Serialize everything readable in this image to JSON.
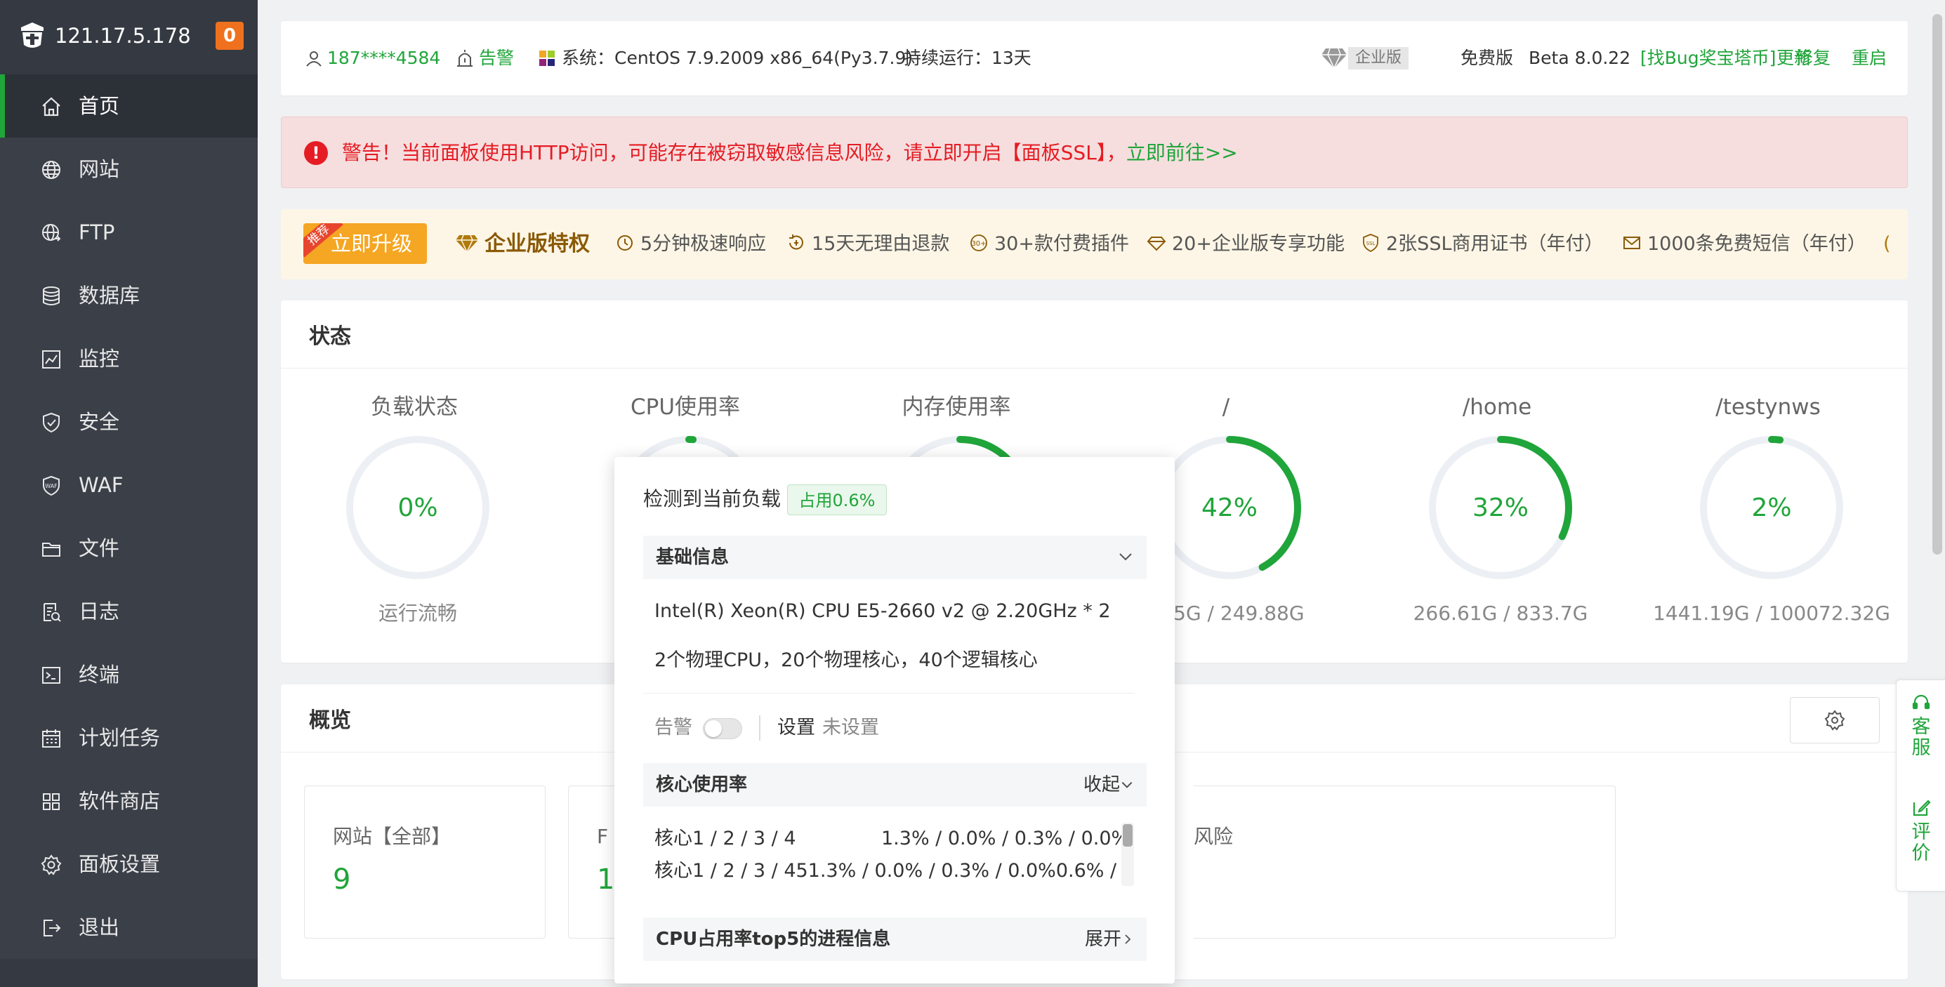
{
  "sidebar": {
    "server_ip": "121.17.5.178",
    "notification_count": "0",
    "items": [
      {
        "label": "首页",
        "icon": "home-icon"
      },
      {
        "label": "网站",
        "icon": "globe-icon"
      },
      {
        "label": "FTP",
        "icon": "ftp-globe-icon"
      },
      {
        "label": "数据库",
        "icon": "database-icon"
      },
      {
        "label": "监控",
        "icon": "monitor-icon"
      },
      {
        "label": "安全",
        "icon": "shield-icon"
      },
      {
        "label": "WAF",
        "icon": "waf-shield-icon"
      },
      {
        "label": "文件",
        "icon": "folder-icon"
      },
      {
        "label": "日志",
        "icon": "log-icon"
      },
      {
        "label": "终端",
        "icon": "terminal-icon"
      },
      {
        "label": "计划任务",
        "icon": "calendar-icon"
      },
      {
        "label": "软件商店",
        "icon": "grid-icon"
      },
      {
        "label": "面板设置",
        "icon": "gear-icon"
      },
      {
        "label": "退出",
        "icon": "logout-icon"
      }
    ]
  },
  "topbar": {
    "user": "187****4584",
    "alarm": "告警",
    "system": "系统：CentOS 7.9.2009 x86_64(Py3.7.9)",
    "uptime": "持续运行：13天",
    "edition_badge": "企业版",
    "free_edition": "免费版",
    "version": "Beta 8.0.22",
    "bug_bounty": "[找Bug奖宝塔币]",
    "update": "更新",
    "repair": "修复",
    "restart": "重启"
  },
  "alert": {
    "icon": "exclamation-icon",
    "text": "警告！当前面板使用HTTP访问，可能存在被窃取敏感信息风险，请立即开启【面板SSL】，",
    "link": "立即前往>>",
    "color": "#e51c23"
  },
  "promo": {
    "tag": "推荐",
    "upgrade": "立即升级",
    "enterprise": "企业版特权",
    "features": [
      "5分钟极速响应",
      "15天无理由退款",
      "30+款付费插件",
      "20+企业版专享功能",
      "2张SSL商用证书（年付）",
      "1000条免费短信（年付）"
    ],
    "feature_icon_30": "30+"
  },
  "status": {
    "title": "状态",
    "gauges": [
      {
        "title": "负载状态",
        "value": "0%",
        "sub": "运行流畅",
        "percent": 0
      },
      {
        "title": "CPU使用率",
        "value": "",
        "sub": "",
        "percent": 1
      },
      {
        "title": "内存使用率",
        "value": "",
        "sub": "",
        "percent": 18
      },
      {
        "title": "/",
        "value": "42%",
        "sub": ".85G / 249.88G",
        "percent": 42
      },
      {
        "title": "/home",
        "value": "32%",
        "sub": "266.61G / 833.7G",
        "percent": 32
      },
      {
        "title": "/testynws",
        "value": "2%",
        "sub": "1441.19G / 100072.32G",
        "percent": 2
      }
    ]
  },
  "overview": {
    "title": "概览",
    "boxes": [
      {
        "label": "网站【全部】",
        "value": "9"
      },
      {
        "label": "F",
        "value": "1"
      },
      {
        "label": "风险",
        "value": ""
      }
    ]
  },
  "float": {
    "service": "客服",
    "review": "评价"
  },
  "popup": {
    "title": "检测到当前负载",
    "usage_badge": "占用0.6%",
    "basic_info": "基础信息",
    "cpu_model": "Intel(R) Xeon(R) CPU E5-2660 v2 @ 2.20GHz * 2",
    "cpu_cores": "2个物理CPU，20个物理核心，40个逻辑核心",
    "alarm_label": "告警",
    "settings": "设置",
    "not_set": "未设置",
    "core_usage": "核心使用率",
    "collapse": "收起",
    "core_row1_label": "核心1 / 2 / 3 / 4",
    "core_row1_values": "1.3% / 0.0% / 0.3% / 0.0%",
    "core_row2": "核心1 / 2 / 3 / 451.3% / 0.0% / 0.3% / 0.0%0.6% /",
    "top5": "CPU占用率top5的进程信息",
    "expand": "展开"
  },
  "colors": {
    "accent": "#20a53a",
    "sidebar_bg": "#3a3f48",
    "promo_bg": "#fdf6e6",
    "upgrade_btn": "#f5a623",
    "ring_track": "#eceff4"
  }
}
